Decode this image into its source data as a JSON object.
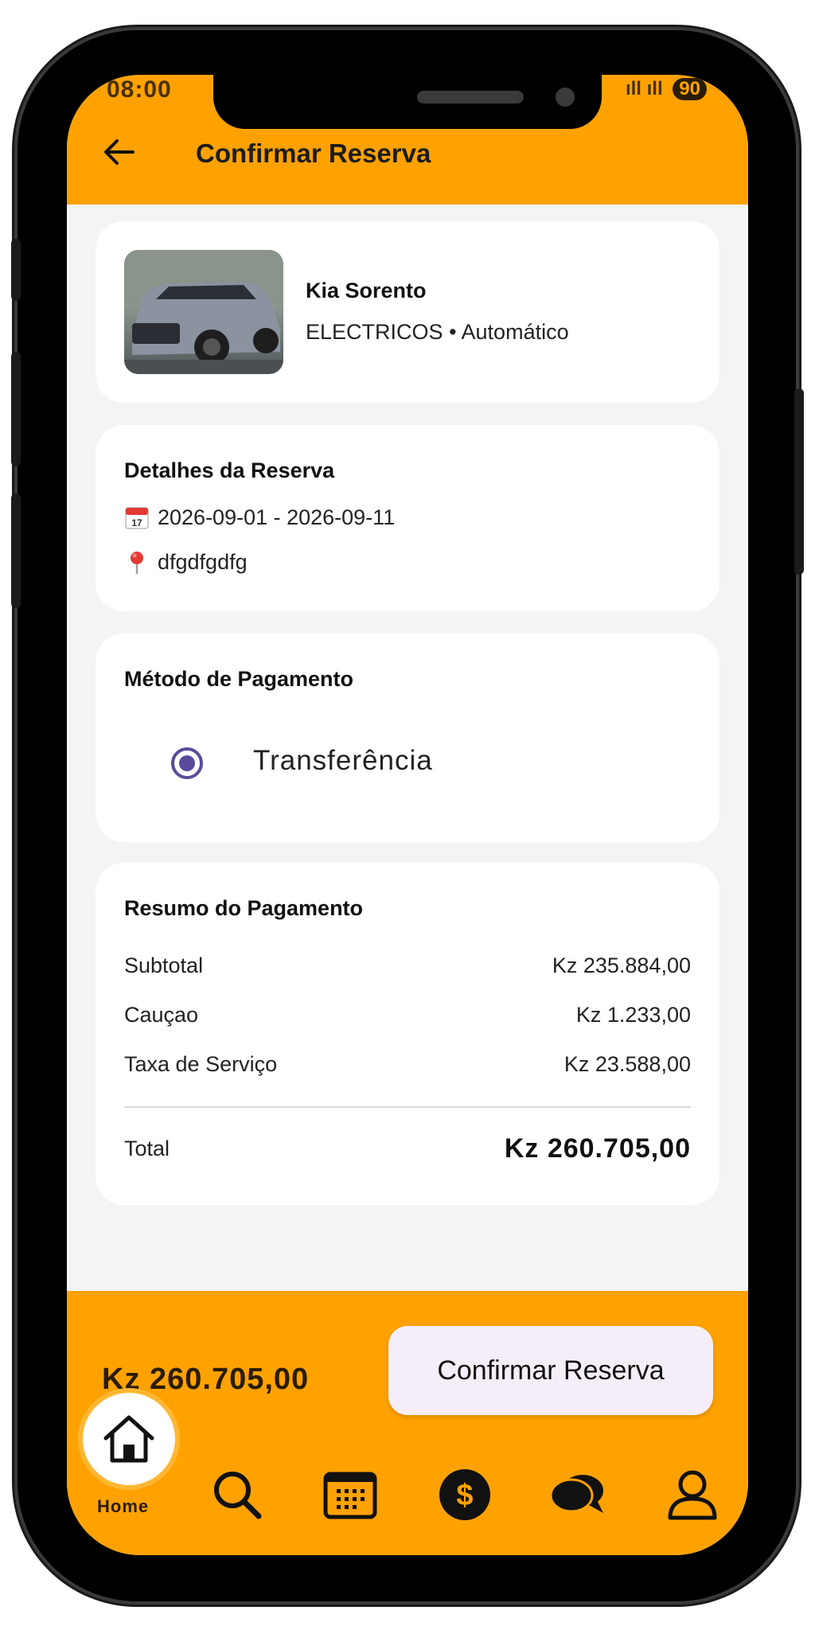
{
  "status_bar": {
    "time": "08:00",
    "signal": "ıll ıll",
    "battery": "90"
  },
  "appbar": {
    "title": "Confirmar Reserva",
    "back_icon": "arrow-left-icon"
  },
  "vehicle": {
    "name": "Kia Sorento",
    "category": "ELECTRICOS",
    "separator": "•",
    "transmission": "Automático",
    "photo_icon": "car-photo"
  },
  "booking_details": {
    "title": "Detalhes da Reserva",
    "dates": "2026-09-01 - 2026-09-11",
    "location": "dfgdfgdfg",
    "date_icon": "calendar-icon",
    "location_icon": "pin-icon"
  },
  "payment_method": {
    "title": "Método de Pagamento",
    "selected": "Transferência"
  },
  "summary": {
    "title": "Resumo do Pagamento",
    "rows": [
      {
        "label": "Subtotal",
        "value": "Kz  235.884,00"
      },
      {
        "label": "Cauçao",
        "value": "Kz  1.233,00"
      },
      {
        "label": "Taxa de Serviço",
        "value": "Kz  23.588,00"
      }
    ],
    "total_label": "Total",
    "total_value": "Kz  260.705,00"
  },
  "bottom_bar": {
    "total": "Kz  260.705,00",
    "confirm_label": "Confirmar Reserva"
  },
  "nav": {
    "home_label": "Home",
    "items": [
      "home-icon",
      "search-icon",
      "calendar-icon",
      "dollar-icon",
      "chat-icon",
      "profile-icon"
    ]
  },
  "colors": {
    "primary": "#FFA200",
    "radio": "#5B4A9B"
  }
}
